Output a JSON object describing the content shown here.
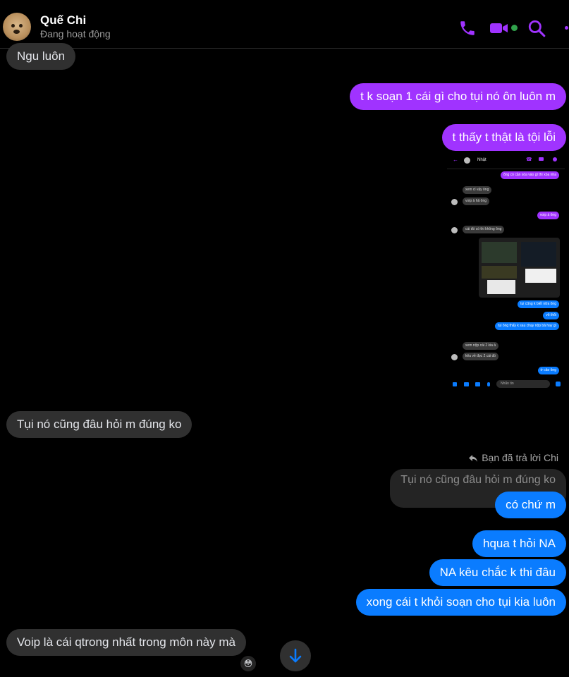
{
  "header": {
    "contact_name": "Quế Chi",
    "contact_status": "Đang hoạt động",
    "accent_color": "#a033ff",
    "online_color": "#31a24c",
    "icons": [
      "phone-icon",
      "video-icon",
      "search-icon",
      "more-icon"
    ]
  },
  "messages": {
    "m1": "Ngu luôn",
    "m2": "t k soạn 1 cái gì cho tụi nó ôn luôn m",
    "m3": "t thấy t thật là tội lỗi",
    "m4": "Tụi nó cũng đâu hỏi m đúng ko",
    "reply_label": "Bạn đã trả lời Chi",
    "quoted_text": "Tụi nó cũng đâu hỏi m đúng ko",
    "m5": "có chứ m",
    "m6": "hqua t hỏi NA",
    "m7": "NA kêu chắc k thi đâu",
    "m8": "xong cái t khỏi soạn cho tụi kia luôn",
    "m9": "Voip là cái qtrong nhất trong môn này mà",
    "m9_reaction": "😳"
  },
  "embedded_screenshot": {
    "contact_name": "Nhật",
    "messages": [
      "ông có cần xóa vào gì thì xóa nha",
      "xem cl vậy ông",
      "voip à hả ông",
      "voip à ông",
      "cái đó có thi không ông",
      "tui cũng k biết nữa ông",
      "vô thôi",
      "tui ông thấy k sau chạy nộp bả hay gì",
      "xem nộp cái 2 kia à",
      "kêu về đọc 2 cái đó",
      "ờ cảo ông"
    ],
    "input_placeholder": "Nhắn tin"
  }
}
